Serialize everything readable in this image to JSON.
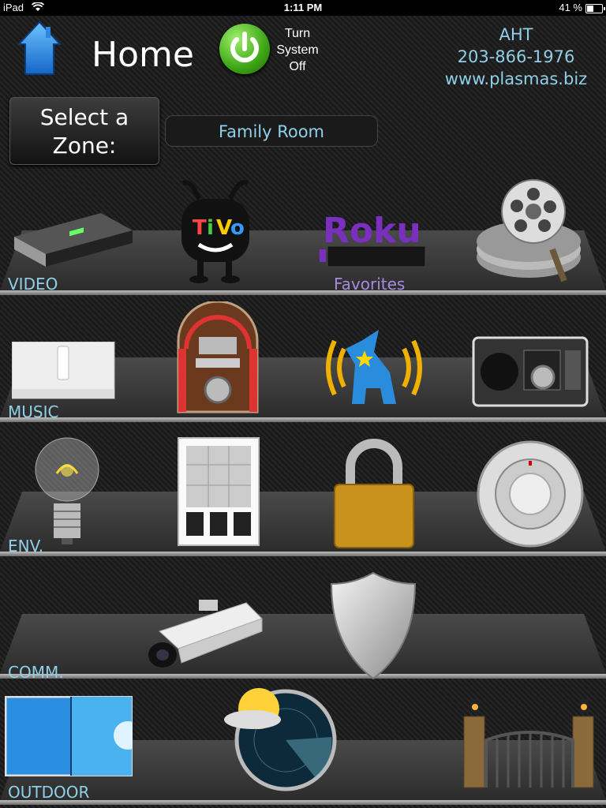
{
  "status_bar": {
    "carrier": "iPad",
    "time": "1:11 PM",
    "battery": "41 %"
  },
  "header": {
    "title": "Home",
    "power_label_lines": [
      "Turn",
      "System",
      "Off"
    ],
    "contact": {
      "company": "AHT",
      "phone": "203-866-1976",
      "website": "www.plasmas.biz"
    }
  },
  "zone": {
    "button_line1": "Select a",
    "button_line2": "Zone:",
    "selected": "Family Room"
  },
  "rows": {
    "video": {
      "label": "VIDEO",
      "favorites_label": "Favorites",
      "items": [
        "cable-box-icon",
        "tivo-icon",
        "roku-icon",
        "film-reels-icon"
      ]
    },
    "music": {
      "label": "MUSIC",
      "items": [
        "sonos-icon",
        "jukebox-icon",
        "pandora-dog-icon",
        "radio-icon"
      ]
    },
    "env": {
      "label": "ENV.",
      "items": [
        "lightbulb-icon",
        "window-shade-icon",
        "padlock-icon",
        "thermostat-icon"
      ]
    },
    "comm": {
      "label": "COMM.",
      "items": [
        "security-camera-icon",
        "shield-icon"
      ]
    },
    "outdoor": {
      "label": "OUTDOOR",
      "items": [
        "pool-icon",
        "weather-radar-icon",
        "gate-icon"
      ]
    }
  },
  "colors": {
    "accent_text": "#8fd0e8",
    "favorites_text": "#a88ae0",
    "power_green": "#3ea616"
  }
}
